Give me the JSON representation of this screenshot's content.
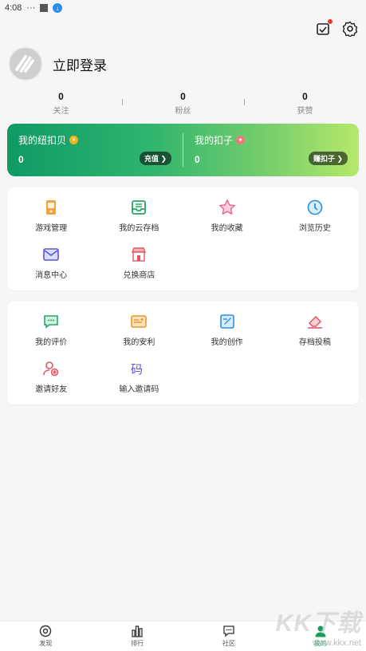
{
  "status": {
    "time": "4:08",
    "dots": "···"
  },
  "profile": {
    "login_label": "立即登录"
  },
  "stats": [
    {
      "num": "0",
      "label": "关注"
    },
    {
      "num": "0",
      "label": "粉丝"
    },
    {
      "num": "0",
      "label": "获赞"
    }
  ],
  "wallet": {
    "left": {
      "title": "我的纽扣贝",
      "value": "0",
      "action": "充值 ❯"
    },
    "right": {
      "title": "我的扣子",
      "value": "0",
      "action": "赚扣子 ❯"
    }
  },
  "grid1": [
    {
      "label": "游戏管理",
      "icon": "game-manage-icon"
    },
    {
      "label": "我的云存档",
      "icon": "cloud-save-icon"
    },
    {
      "label": "我的收藏",
      "icon": "star-icon"
    },
    {
      "label": "浏览历史",
      "icon": "clock-icon"
    },
    {
      "label": "消息中心",
      "icon": "mail-icon"
    },
    {
      "label": "兑换商店",
      "icon": "shop-icon"
    }
  ],
  "grid2": [
    {
      "label": "我的评价",
      "icon": "comment-icon"
    },
    {
      "label": "我的安利",
      "icon": "recommend-icon"
    },
    {
      "label": "我的创作",
      "icon": "edit-icon"
    },
    {
      "label": "存档投稿",
      "icon": "eraser-icon"
    },
    {
      "label": "邀请好友",
      "icon": "invite-user-icon"
    },
    {
      "label": "输入邀请码",
      "icon": "code-icon"
    }
  ],
  "tabs": [
    {
      "label": "发现",
      "icon": "discover-icon"
    },
    {
      "label": "排行",
      "icon": "rank-icon"
    },
    {
      "label": "社区",
      "icon": "community-icon"
    },
    {
      "label": "我的",
      "icon": "profile-icon"
    }
  ],
  "watermark": {
    "big": "KK下载",
    "small": "www.kkx.net"
  },
  "colors": {
    "accent": "#1a9e5c",
    "wallet_start": "#0f9a65",
    "wallet_end": "#b6e96a"
  }
}
